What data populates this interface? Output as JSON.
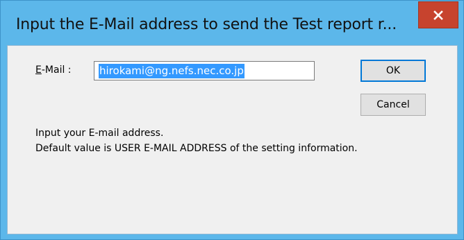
{
  "window": {
    "title": "Input the E-Mail address to send the Test report r...",
    "close_label": "x",
    "colors": {
      "titlebar": "#5cb7ea",
      "close_button": "#c7432e",
      "client": "#f0f0f0",
      "selection": "#3399ff"
    }
  },
  "form": {
    "email_label_prefix": "E",
    "email_label_rest": "-Mail :",
    "email_value": "hirokami@ng.nefs.nec.co.jp"
  },
  "buttons": {
    "ok_label": "OK",
    "cancel_label": "Cancel"
  },
  "messages": {
    "line1": "Input your E-mail address.",
    "line2": "Default value is USER E-MAIL ADDRESS of the setting information."
  }
}
